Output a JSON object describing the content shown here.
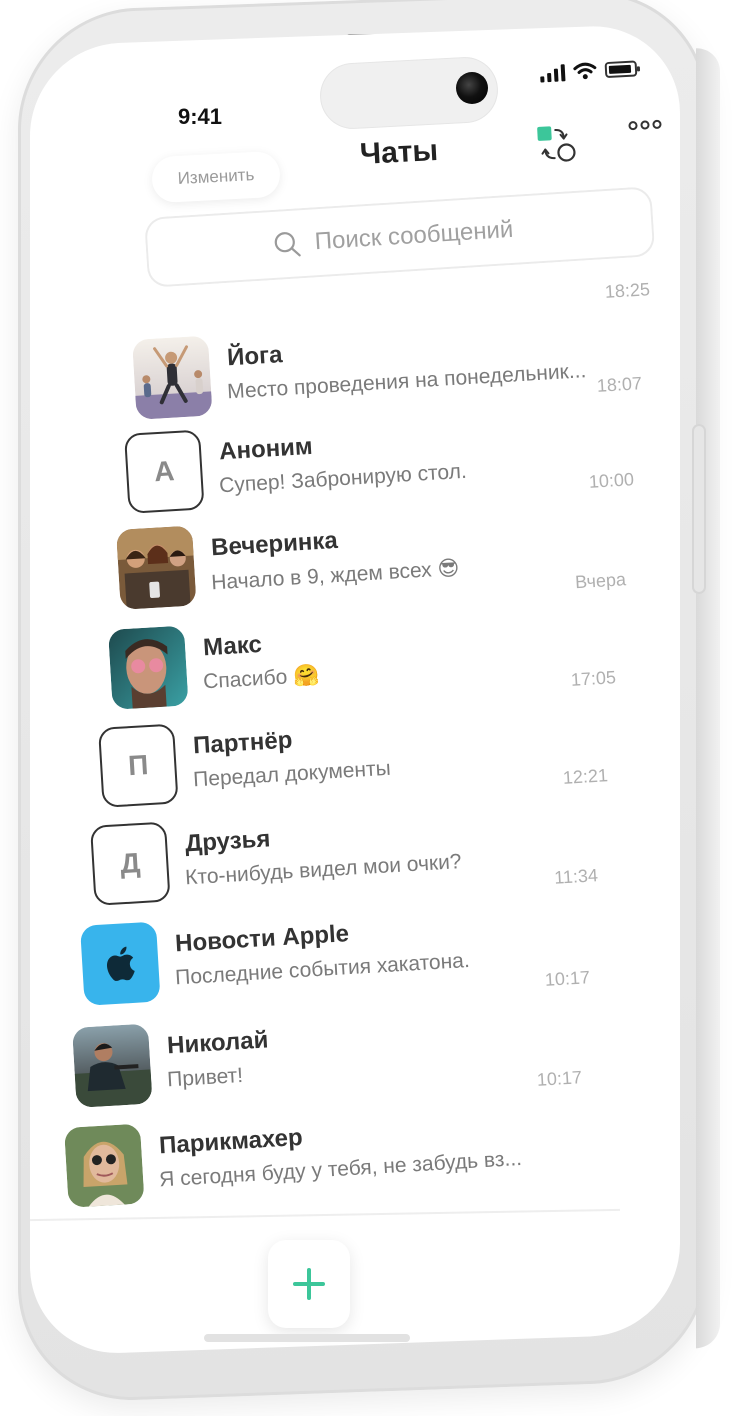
{
  "status_bar": {
    "time": "9:41"
  },
  "header": {
    "edit_label": "Изменить",
    "title": "Чаты",
    "switch_icon": "account-switch-icon",
    "more_icon": "more-dots-icon"
  },
  "search": {
    "placeholder": "Поиск сообщений"
  },
  "colors": {
    "accent": "#3cc69a",
    "apple_blue": "#38b4ec",
    "text_primary": "#333333",
    "text_secondary": "#7a7a7a",
    "time": "#b0b0b0"
  },
  "chats": [
    {
      "name": "Йога",
      "preview": "Место проведения на понедельник...",
      "time": "18:25",
      "avatar": "photo"
    },
    {
      "name": "Аноним",
      "preview": "Супер! Забронирую стол.",
      "time": "18:07",
      "avatar": "letter",
      "letter": "А"
    },
    {
      "name": "Вечеринка",
      "preview": "Начало в 9, ждем всех 😎",
      "time": "10:00",
      "avatar": "photo"
    },
    {
      "name": "Макс",
      "preview": "Спасибо 🤗",
      "time": "Вчера",
      "avatar": "photo"
    },
    {
      "name": "Партнёр",
      "preview": "Передал документы",
      "time": "17:05",
      "avatar": "letter",
      "letter": "П"
    },
    {
      "name": "Друзья",
      "preview": "Кто-нибудь видел мои очки?",
      "time": "12:21",
      "avatar": "letter",
      "letter": "Д"
    },
    {
      "name": "Новости Apple",
      "preview": "Последние события хакатона.",
      "time": "11:34",
      "avatar": "apple"
    },
    {
      "name": "Николай",
      "preview": "Привет!",
      "time": "10:17",
      "avatar": "photo"
    },
    {
      "name": "Парикмахер",
      "preview": "Я сегодня буду у тебя, не забудь вз...",
      "time": "10:17",
      "avatar": "photo"
    }
  ],
  "bottom": {
    "add_icon": "plus-icon"
  }
}
